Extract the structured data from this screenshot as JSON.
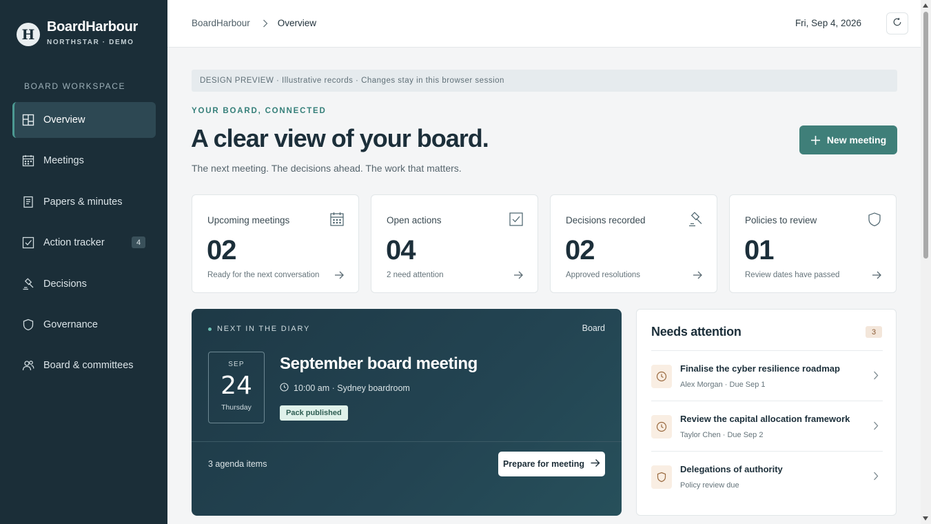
{
  "brand": {
    "mark": "H",
    "name": "BoardHarbour",
    "subtitle": "NORTHSTAR · DEMO"
  },
  "sidebar": {
    "section_label": "BOARD WORKSPACE",
    "items": [
      {
        "label": "Overview",
        "icon": "layout-icon",
        "active": true
      },
      {
        "label": "Meetings",
        "icon": "calendar-icon"
      },
      {
        "label": "Papers & minutes",
        "icon": "document-icon"
      },
      {
        "label": "Action tracker",
        "icon": "checkbox-icon",
        "badge": "4"
      },
      {
        "label": "Decisions",
        "icon": "gavel-icon"
      },
      {
        "label": "Governance",
        "icon": "shield-icon"
      },
      {
        "label": "Board & committees",
        "icon": "people-icon"
      }
    ]
  },
  "header": {
    "breadcrumb_root": "BoardHarbour",
    "breadcrumb_current": "Overview",
    "date": "Fri, Sep 4, 2026"
  },
  "main": {
    "preview_banner": "DESIGN PREVIEW · Illustrative records · Changes stay in this browser session",
    "eyebrow": "YOUR BOARD, CONNECTED",
    "headline": "A clear view of your board.",
    "subline": "The next meeting. The decisions ahead. The work that matters.",
    "new_meeting_label": "New meeting"
  },
  "stats": [
    {
      "label": "Upcoming meetings",
      "value": "02",
      "note": "Ready for the next conversation",
      "icon": "calendar-icon"
    },
    {
      "label": "Open actions",
      "value": "04",
      "note": "2 need attention",
      "icon": "checkbox-icon"
    },
    {
      "label": "Decisions recorded",
      "value": "02",
      "note": "Approved resolutions",
      "icon": "gavel-icon"
    },
    {
      "label": "Policies to review",
      "value": "01",
      "note": "Review dates have passed",
      "icon": "shield-icon"
    }
  ],
  "next_meeting": {
    "eyebrow": "NEXT IN THE DIARY",
    "committee": "Board",
    "month": "SEP",
    "day": "24",
    "weekday": "Thursday",
    "title": "September board meeting",
    "time_location": "10:00 am · Sydney boardroom",
    "status": "Pack published",
    "agenda": "3 agenda items",
    "prepare_label": "Prepare for meeting"
  },
  "attention": {
    "title": "Needs attention",
    "count": "3",
    "items": [
      {
        "title": "Finalise the cyber resilience roadmap",
        "meta": "Alex Morgan · Due Sep 1",
        "icon": "clock-icon"
      },
      {
        "title": "Review the capital allocation framework",
        "meta": "Taylor Chen · Due Sep 2",
        "icon": "clock-icon"
      },
      {
        "title": "Delegations of authority",
        "meta": "Policy review due",
        "icon": "shield-icon"
      }
    ]
  },
  "colors": {
    "sidebar_bg": "#1b2e38",
    "accent": "#3f7f79",
    "meeting_card": "#234452",
    "attention_icon_bg": "#f9eee3"
  }
}
